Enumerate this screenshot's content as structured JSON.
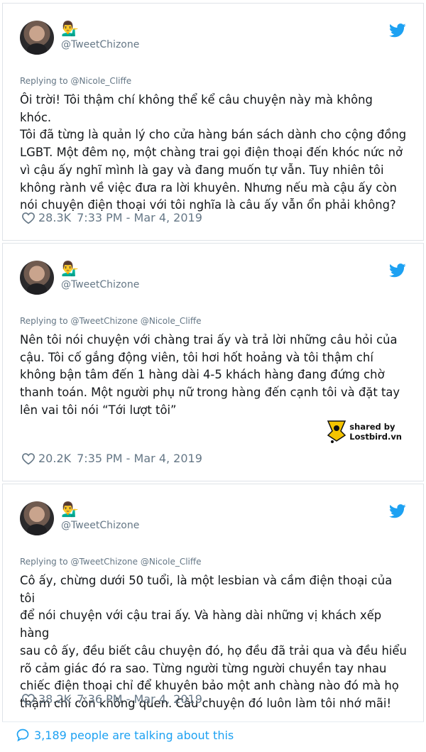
{
  "tweets": [
    {
      "handle": "@TweetChizone",
      "emoji": "💁‍♂️",
      "reply_to": "Replying to @Nicole_Cliffe",
      "text": "Ôi trời! Tôi thậm chí không thể kể câu chuyện này mà không khóc.\nTôi đã từng là quản lý cho cửa hàng bán sách dành cho cộng đồng\nLGBT. Một đêm nọ, một chàng trai gọi điện thoại đến khóc nức nở\nvì cậu ấy nghĩ mình là gay và đang muốn tự vẫn. Tuy nhiên tôi\nkhông rành về việc đưa ra lời khuyên. Nhưng nếu mà cậu ấy còn\nnói chuyện điện thoại với tôi nghĩa là câu ấy vẫn ổn phải không?",
      "likes": "28.3K",
      "time": "7:33 PM - Mar 4, 2019"
    },
    {
      "handle": "@TweetChizone",
      "emoji": "💁‍♂️",
      "reply_to": "Replying to @TweetChizone @Nicole_Cliffe",
      "text": "Nên tôi nói chuyện với chàng trai ấy và trả lời những câu hỏi của\ncậu. Tôi cố gắng động viên, tôi hơi hốt hoảng và tôi thậm chí\nkhông bận tâm đến 1 hàng dài 4-5 khách hàng đang đứng chờ\nthanh toán. Một người phụ nữ trong hàng đến cạnh tôi và đặt tay\nlên vai tôi nói “Tới lượt tôi”",
      "likes": "20.2K",
      "time": "7:35 PM - Mar 4, 2019"
    },
    {
      "handle": "@TweetChizone",
      "emoji": "💁‍♂️",
      "reply_to": "Replying to @TweetChizone @Nicole_Cliffe",
      "text": "Cô ấy, chừng dưới 50 tuổi, là một lesbian và cầm điện thoại của tôi\nđể nói chuyện với cậu trai ấy. Và hàng dài những vị khách xếp hàng\nsau cô ấy, đều biết câu chuyện đó, họ đều đã trải qua và đều hiểu\nrõ cảm giác đó ra sao. Từng người từng người chuyền tay nhau\nchiếc điện thoại chỉ để khuyên bảo một anh chàng nào đó mà họ\nthậm chí còn không quen. Câu chuyện đó luôn làm tôi nhớ mãi!",
      "likes": "38.2K",
      "time": "7:36 PM - Mar 4, 2019"
    }
  ],
  "watermark": {
    "line1": "shared by",
    "line2": "Lostbird.vn"
  },
  "footer": {
    "talking": "3,189 people are talking about this"
  },
  "colors": {
    "twitter_blue": "#1da1f2",
    "muted": "#657786",
    "text": "#14171a",
    "border": "#dfe3e8"
  },
  "icons": {
    "bird": "twitter-bird-icon",
    "heart": "heart-icon",
    "comment": "comment-bubble-icon"
  }
}
